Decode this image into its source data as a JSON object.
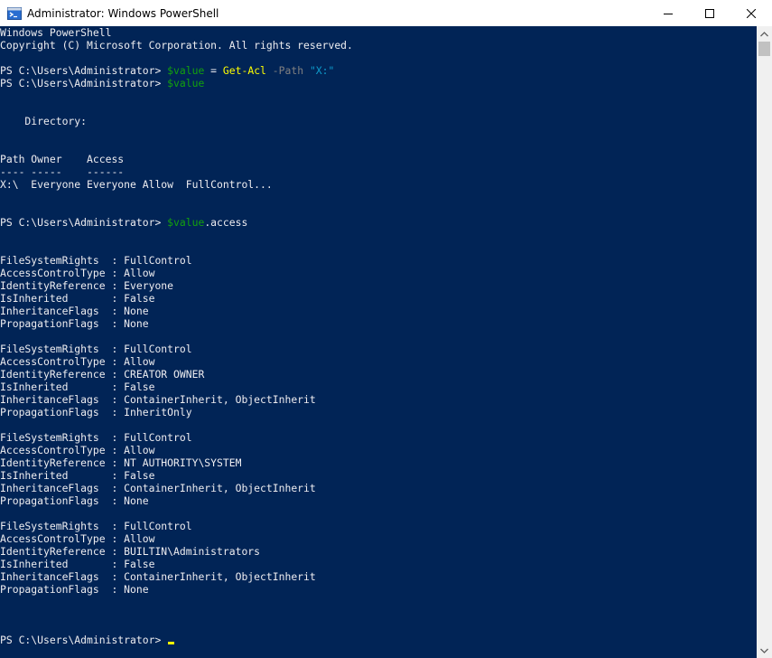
{
  "window": {
    "title": "Administrator: Windows PowerShell",
    "icon": "powershell-icon",
    "controls": [
      "minimize-icon",
      "maximize-icon",
      "close-icon"
    ]
  },
  "colors": {
    "background": "#012456",
    "text": "#eeedf0",
    "command": "#ffff00",
    "variable": "#13a10e",
    "parameter": "#808080",
    "string": "#0e9ccc"
  },
  "console": {
    "lines": [
      [
        {
          "t": "Windows PowerShell"
        }
      ],
      [
        {
          "t": "Copyright (C) Microsoft Corporation. All rights reserved."
        }
      ],
      [],
      [
        {
          "t": "PS C:\\Users\\Administrator> "
        },
        {
          "t": "$value",
          "c": "var"
        },
        {
          "t": " = "
        },
        {
          "t": "Get-Acl",
          "c": "kw"
        },
        {
          "t": " "
        },
        {
          "t": "-Path",
          "c": "param"
        },
        {
          "t": " "
        },
        {
          "t": "\"X:\"",
          "c": "str"
        }
      ],
      [
        {
          "t": "PS C:\\Users\\Administrator> "
        },
        {
          "t": "$value",
          "c": "var"
        }
      ],
      [],
      [],
      [
        {
          "t": "    Directory:"
        }
      ],
      [],
      [],
      [
        {
          "t": "Path Owner    Access"
        }
      ],
      [
        {
          "t": "---- -----    ------"
        }
      ],
      [
        {
          "t": "X:\\  Everyone Everyone Allow  FullControl..."
        }
      ],
      [],
      [],
      [
        {
          "t": "PS C:\\Users\\Administrator> "
        },
        {
          "t": "$value",
          "c": "var"
        },
        {
          "t": ".access"
        }
      ],
      [],
      [],
      [
        {
          "t": "FileSystemRights  : FullControl"
        }
      ],
      [
        {
          "t": "AccessControlType : Allow"
        }
      ],
      [
        {
          "t": "IdentityReference : Everyone"
        }
      ],
      [
        {
          "t": "IsInherited       : False"
        }
      ],
      [
        {
          "t": "InheritanceFlags  : None"
        }
      ],
      [
        {
          "t": "PropagationFlags  : None"
        }
      ],
      [],
      [
        {
          "t": "FileSystemRights  : FullControl"
        }
      ],
      [
        {
          "t": "AccessControlType : Allow"
        }
      ],
      [
        {
          "t": "IdentityReference : CREATOR OWNER"
        }
      ],
      [
        {
          "t": "IsInherited       : False"
        }
      ],
      [
        {
          "t": "InheritanceFlags  : ContainerInherit, ObjectInherit"
        }
      ],
      [
        {
          "t": "PropagationFlags  : InheritOnly"
        }
      ],
      [],
      [
        {
          "t": "FileSystemRights  : FullControl"
        }
      ],
      [
        {
          "t": "AccessControlType : Allow"
        }
      ],
      [
        {
          "t": "IdentityReference : NT AUTHORITY\\SYSTEM"
        }
      ],
      [
        {
          "t": "IsInherited       : False"
        }
      ],
      [
        {
          "t": "InheritanceFlags  : ContainerInherit, ObjectInherit"
        }
      ],
      [
        {
          "t": "PropagationFlags  : None"
        }
      ],
      [],
      [
        {
          "t": "FileSystemRights  : FullControl"
        }
      ],
      [
        {
          "t": "AccessControlType : Allow"
        }
      ],
      [
        {
          "t": "IdentityReference : BUILTIN\\Administrators"
        }
      ],
      [
        {
          "t": "IsInherited       : False"
        }
      ],
      [
        {
          "t": "InheritanceFlags  : ContainerInherit, ObjectInherit"
        }
      ],
      [
        {
          "t": "PropagationFlags  : None"
        }
      ],
      [],
      [],
      [],
      [
        {
          "t": "PS C:\\Users\\Administrator> "
        }
      ]
    ]
  },
  "scrollbar": {
    "up_icon": "scroll-up-arrow-icon",
    "down_icon": "scroll-down-arrow-icon"
  }
}
